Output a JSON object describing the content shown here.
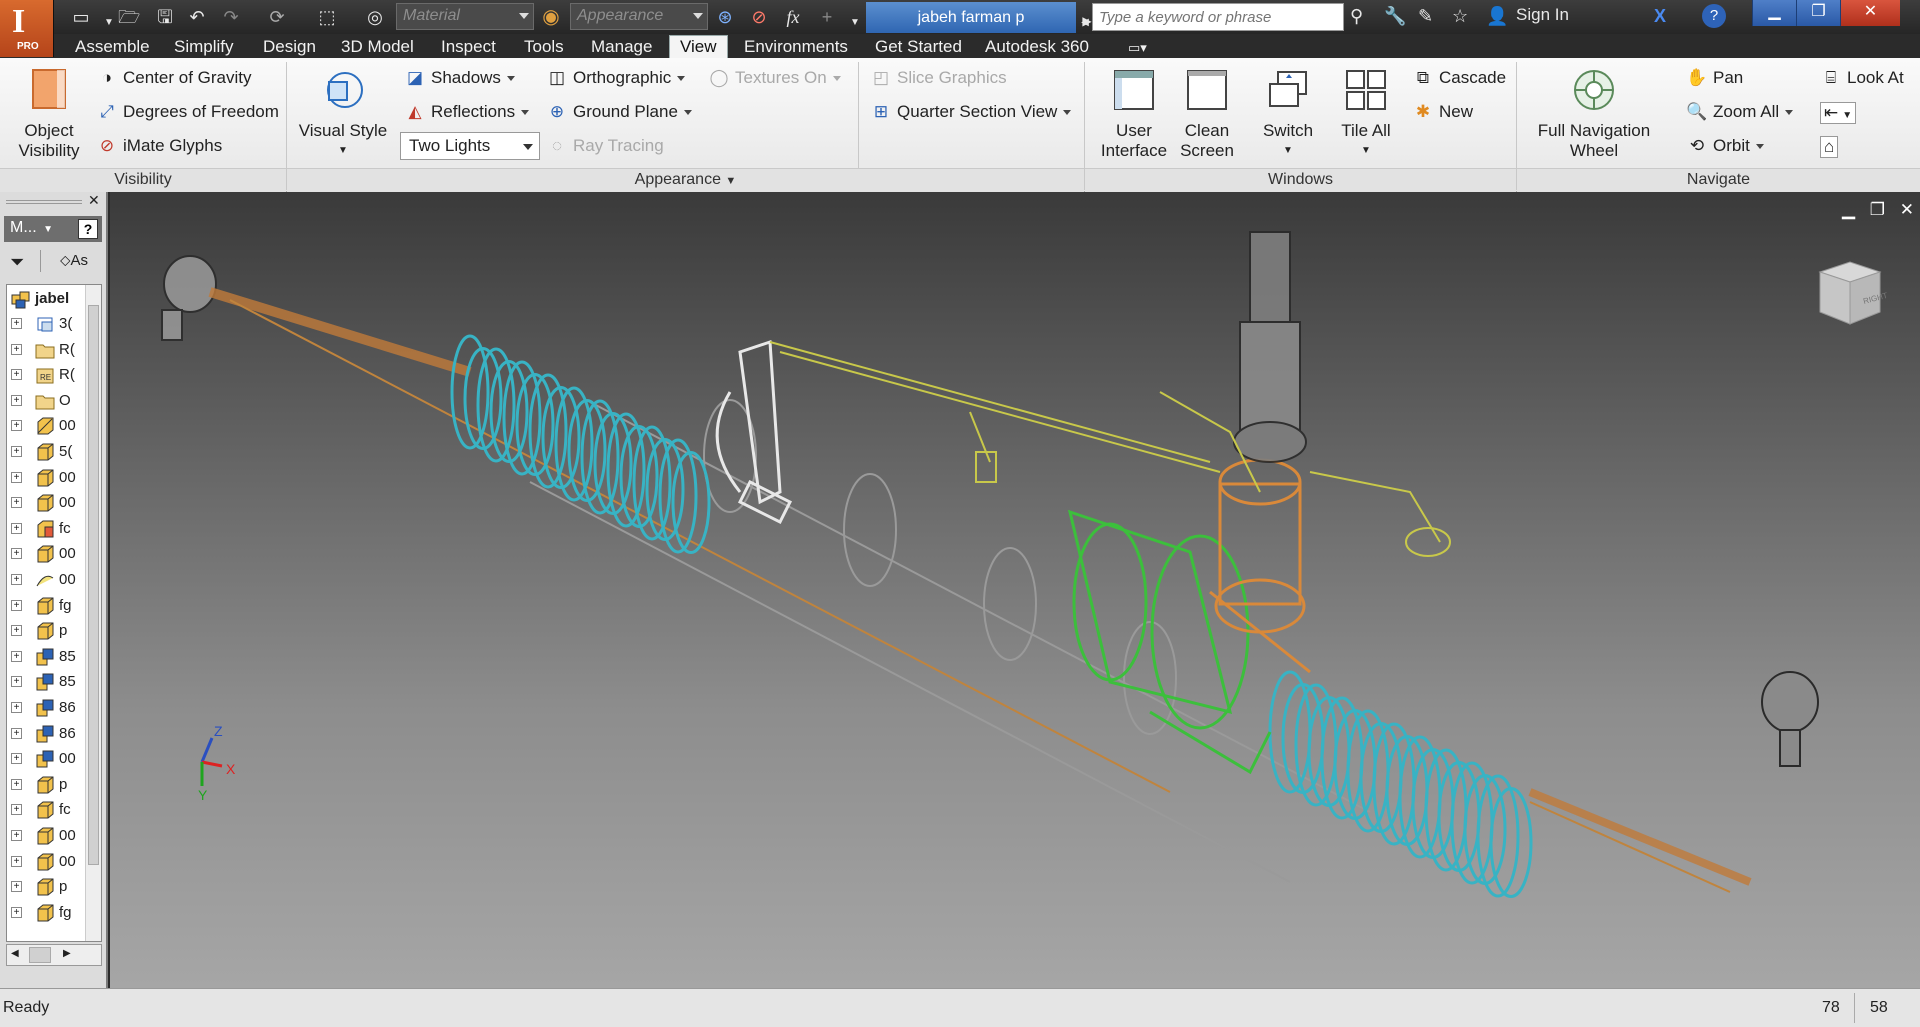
{
  "titlebar": {
    "logo_letter": "I",
    "logo_edition": "PRO",
    "material_placeholder": "Material",
    "appearance_placeholder": "Appearance",
    "fx_label": "fx",
    "document_tab": "jabeh farman p",
    "search_placeholder": "Type a keyword or phrase",
    "sign_in": "Sign In"
  },
  "menu": {
    "tabs": [
      "Assemble",
      "Simplify",
      "Design",
      "3D Model",
      "Inspect",
      "Tools",
      "Manage",
      "View",
      "Environments",
      "Get Started",
      "Autodesk 360"
    ],
    "active": "View"
  },
  "ribbon": {
    "visibility": {
      "title": "Visibility",
      "object_visibility": "Object Visibility",
      "object_visibility_line1": "Object",
      "object_visibility_line2": "Visibility",
      "center_of_gravity": "Center of Gravity",
      "degrees_of_freedom": "Degrees of Freedom",
      "imate_glyphs": "iMate Glyphs"
    },
    "appearance": {
      "title": "Appearance",
      "visual_style": "Visual Style",
      "shadows": "Shadows",
      "reflections": "Reflections",
      "lighting": "Two Lights",
      "orthographic": "Orthographic",
      "ground_plane": "Ground Plane",
      "ray_tracing": "Ray Tracing",
      "textures_on": "Textures On",
      "slice_graphics": "Slice Graphics",
      "quarter_section_view": "Quarter Section View"
    },
    "windows": {
      "title": "Windows",
      "user_interface_line1": "User",
      "user_interface_line2": "Interface",
      "clean_screen_line1": "Clean",
      "clean_screen_line2": "Screen",
      "switch": "Switch",
      "tile_all": "Tile All",
      "cascade": "Cascade",
      "new": "New"
    },
    "navigate": {
      "title": "Navigate",
      "full_nav_wheel_line1": "Full Navigation",
      "full_nav_wheel_line2": "Wheel",
      "pan": "Pan",
      "zoom_all": "Zoom All",
      "orbit": "Orbit",
      "look_at": "Look At"
    }
  },
  "browser": {
    "header": "M...",
    "help": "?",
    "filter_label": "As",
    "root": "jabel",
    "items": [
      "3(",
      "R(",
      "R(",
      "O",
      "00",
      "5(",
      "00",
      "00",
      "fc",
      "00",
      "00",
      "fg",
      "p",
      "85",
      "85",
      "86",
      "86",
      "00",
      "p",
      "fc",
      "00",
      "00",
      "p",
      "fg"
    ]
  },
  "viewport": {
    "axis_z": "Z",
    "axis_x": "X",
    "axis_y": "Y",
    "viewcube_label": "RIGHT"
  },
  "status": {
    "text": "Ready",
    "num1": "78",
    "num2": "58"
  },
  "colors": {
    "accent_blue": "#2f66b2",
    "bellows": "#38b3c4",
    "rack_tube": "#8a8a8a",
    "housing_green": "#3cbf3c",
    "valve_orange": "#d9893a",
    "pipe_yellow": "#c8c84a"
  }
}
